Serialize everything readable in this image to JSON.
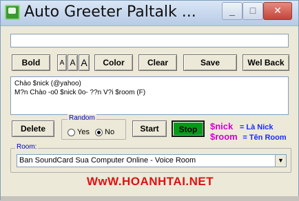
{
  "window": {
    "title": "Auto Greeter Paltalk ...",
    "controls": {
      "minimize": "_",
      "maximize": "□",
      "close": "✕"
    }
  },
  "top_input": {
    "value": ""
  },
  "format_buttons": {
    "bold": "Bold",
    "font_small": "A",
    "font_medium": "A",
    "font_large": "A",
    "color": "Color",
    "clear": "Clear",
    "save": "Save",
    "wel_back": "Wel Back"
  },
  "greeting_text": {
    "line1": "Chào $nick (@yahoo)",
    "line2": "M?n Chào -o0 $nick 0o- ??n V?i $room (F)"
  },
  "actions": {
    "delete": "Delete",
    "start": "Start",
    "stop": "Stop"
  },
  "random": {
    "label": "Random",
    "yes": "Yes",
    "no": "No",
    "selected": "No"
  },
  "legend": {
    "nick_var": "$nick",
    "nick_desc": "= Là Nick",
    "room_var": "$room",
    "room_desc": "= Tên Room",
    "nick_color": "#d000d0",
    "desc_color": "#1a2cff"
  },
  "room": {
    "label": "Room:",
    "selected": "Ban SoundCard Sua Computer Online - Voice Room"
  },
  "footer": {
    "site": "WwW.HOANHTAI.NET",
    "color": "#e01010"
  }
}
